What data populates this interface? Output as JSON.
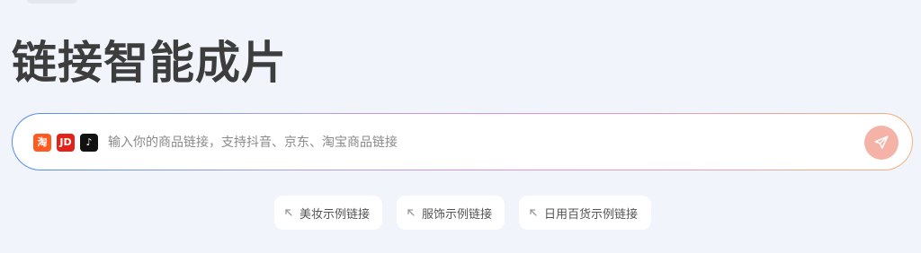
{
  "title": "链接智能成片",
  "search": {
    "placeholder": "输入你的商品链接，支持抖音、京东、淘宝商品链接",
    "value": "",
    "platforms": [
      {
        "name": "淘宝",
        "label": "淘",
        "icon": "taobao-icon",
        "color": "#ff5a1f"
      },
      {
        "name": "京东",
        "label": "JD",
        "icon": "jd-icon",
        "color": "#e2231a"
      },
      {
        "name": "抖音",
        "label": "♪",
        "icon": "douyin-icon",
        "color": "#111111"
      }
    ],
    "send_icon": "paper-plane-icon",
    "send_color": "#f5b3a8"
  },
  "examples": [
    {
      "label": "美妆示例链接",
      "icon": "arrow-up-left-icon"
    },
    {
      "label": "服饰示例链接",
      "icon": "arrow-up-left-icon"
    },
    {
      "label": "日用百货示例链接",
      "icon": "arrow-up-left-icon"
    }
  ],
  "colors": {
    "background": "#f1f5fb",
    "title": "#3d3d3d",
    "border_gradient": [
      "#4f8df2",
      "#a79ff0",
      "#ee8fd2",
      "#f2b27c"
    ]
  }
}
